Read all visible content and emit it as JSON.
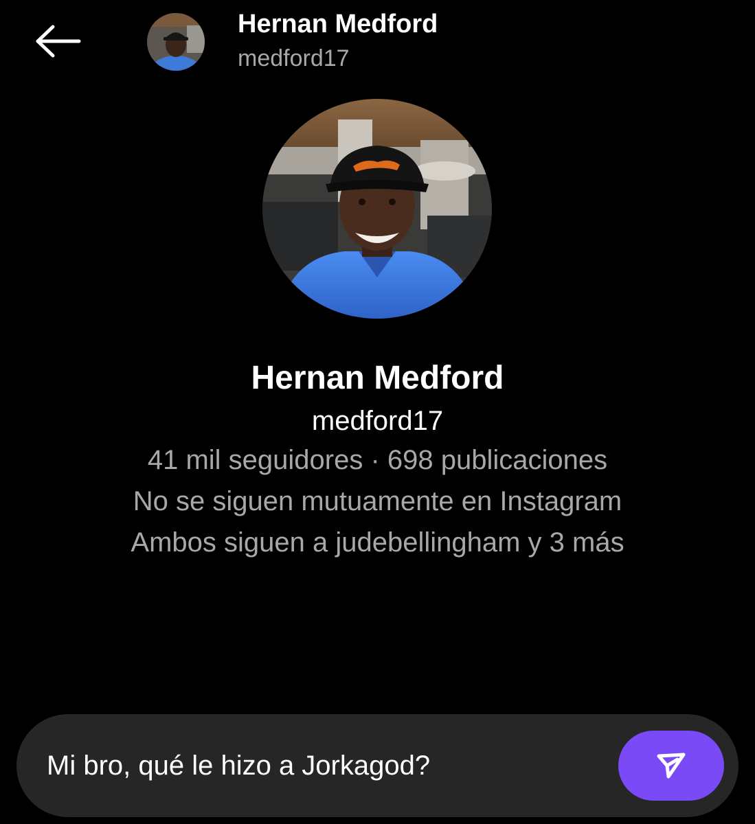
{
  "header": {
    "back_icon": "arrow-left-icon",
    "name": "Hernan Medford",
    "username": "medford17"
  },
  "profile": {
    "name": "Hernan Medford",
    "username": "medford17",
    "stats": "41 mil seguidores · 698 publicaciones",
    "mutual_follow": "No se siguen mutuamente en Instagram",
    "mutual_accounts": "Ambos siguen a judebellingham y 3 más"
  },
  "composer": {
    "message": "Mi bro, qué le hizo a Jorkagod?",
    "send_icon": "send-icon"
  },
  "colors": {
    "background": "#000000",
    "secondary_text": "#a8a8a8",
    "composer_bg": "#262626",
    "send_accent": "#7a4af7"
  }
}
